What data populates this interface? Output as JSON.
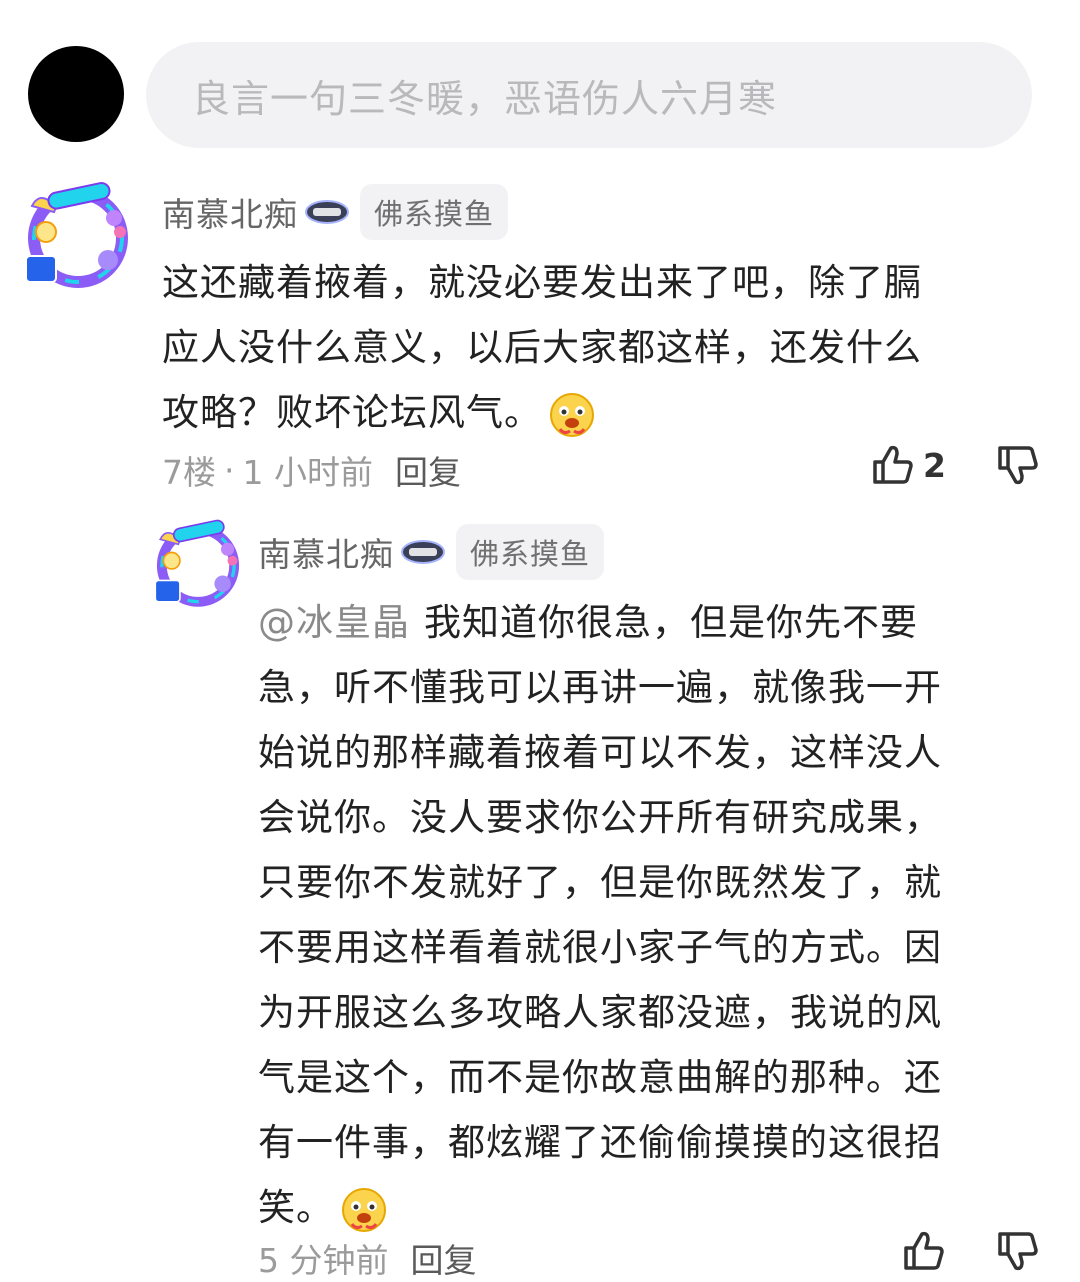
{
  "composer": {
    "placeholder": "良言一句三冬暖，恶语伤人六月寒"
  },
  "comments": [
    {
      "username": "南慕北痴",
      "tag": "佛系摸鱼",
      "lines": [
        "这还藏着掖着，就没必要发出来了吧，除了膈",
        "应人没什么意义，以后大家都这样，还发什么",
        "攻略？败坏论坛风气。"
      ],
      "floor": "7楼",
      "sep": "·",
      "time": "1 小时前",
      "reply_label": "回复",
      "likes": "2"
    },
    {
      "username": "南慕北痴",
      "tag": "佛系摸鱼",
      "mention": "@冰皇晶",
      "lines": [
        "我知道你很急，但是你先不要",
        "急，听不懂我可以再讲一遍，就像我一开",
        "始说的那样藏着掖着可以不发，这样没人",
        "会说你。没人要求你公开所有研究成果，",
        "只要你不发就好了，但是你既然发了，就",
        "不要用这样看着就很小家子气的方式。因",
        "为开服这么多攻略人家都没遮，我说的风",
        "气是这个，而不是你故意曲解的那种。还",
        "有一件事，都炫耀了还偷偷摸摸的这很招",
        "笑。"
      ],
      "time": "5 分钟前",
      "reply_label": "回复"
    }
  ],
  "colors": {
    "badge_purple": "#8b5cf6",
    "badge_yellow": "#fcd34d",
    "badge_cyan": "#22d3ee"
  },
  "icons": {
    "like": "thumbs-up-icon",
    "dislike": "thumbs-down-icon",
    "emoji": "drooling-face-emoji"
  }
}
